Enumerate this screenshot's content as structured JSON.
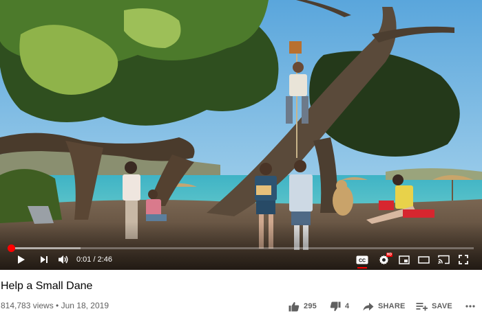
{
  "player": {
    "current_time": "0:01",
    "duration": "2:46",
    "time_separator": "/",
    "progress_fraction": 0.006,
    "buffered_fraction": 0.155,
    "accent_color": "#ff0000",
    "settings_badge": "HD"
  },
  "video": {
    "title": "Help a Small Dane",
    "views": "814,783 views",
    "date": "Jun 18, 2019",
    "meta_separator": " • "
  },
  "actions": {
    "likes": "295",
    "dislikes": "4",
    "share_label": "SHARE",
    "save_label": "SAVE"
  },
  "icons": [
    "play-icon",
    "next-icon",
    "volume-icon",
    "captions-icon",
    "settings-icon",
    "miniplayer-icon",
    "theater-icon",
    "cast-icon",
    "fullscreen-icon",
    "thumbs-up-icon",
    "thumbs-down-icon",
    "share-icon",
    "save-icon",
    "more-icon"
  ]
}
